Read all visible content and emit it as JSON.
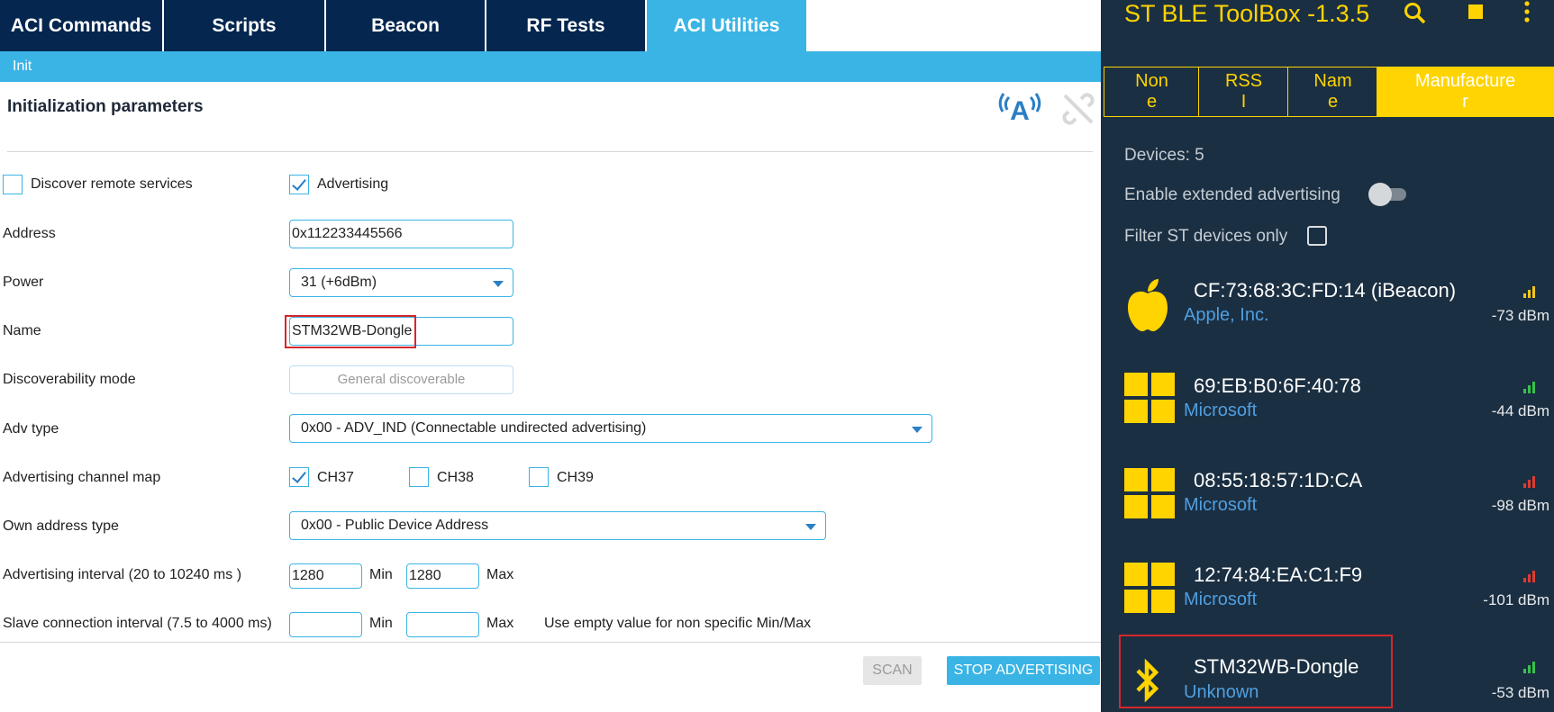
{
  "left": {
    "tabs": [
      "ACI Commands",
      "Scripts",
      "Beacon",
      "RF Tests",
      "ACI Utilities"
    ],
    "active_tab": "ACI Utilities",
    "subtab": "Init",
    "section_title": "Initialization parameters",
    "form": {
      "discover_remote_services": {
        "label": "Discover remote services",
        "checked": false
      },
      "advertising": {
        "label": "Advertising",
        "checked": true
      },
      "address": {
        "label": "Address",
        "value": "0x112233445566"
      },
      "power": {
        "label": "Power",
        "value": "31 (+6dBm)"
      },
      "name": {
        "label": "Name",
        "value": "STM32WB-Dongle"
      },
      "discoverability_mode": {
        "label": "Discoverability mode",
        "value": "General discoverable"
      },
      "adv_type": {
        "label": "Adv type",
        "value": "0x00 - ADV_IND (Connectable undirected advertising)"
      },
      "channel_map": {
        "label": "Advertising channel map",
        "channels": [
          {
            "label": "CH37",
            "checked": true
          },
          {
            "label": "CH38",
            "checked": false
          },
          {
            "label": "CH39",
            "checked": false
          }
        ]
      },
      "own_address_type": {
        "label": "Own address type",
        "value": "0x00 - Public Device Address"
      },
      "advertising_interval": {
        "label": "Advertising interval (20 to 10240 ms )",
        "min": "1280",
        "max": "1280",
        "min_label": "Min",
        "max_label": "Max"
      },
      "slave_connection_interval": {
        "label": "Slave connection interval (7.5 to 4000 ms)",
        "min": "",
        "max": "",
        "min_label": "Min",
        "max_label": "Max",
        "hint": "Use empty value for non specific Min/Max"
      }
    },
    "buttons": {
      "scan": "SCAN",
      "stop_advertising": "STOP ADVERTISING"
    },
    "colors": {
      "tab_bg": "#04264f",
      "accent": "#3ab4e5",
      "highlight": "#d6262b"
    }
  },
  "right": {
    "app_title": "ST BLE ToolBox -1.3.5",
    "sort_tabs": [
      "Non\ne",
      "RSS\nI",
      "Nam\ne",
      "Manufacture\nr"
    ],
    "active_sort_tab": "Manufacture\nr",
    "devices_count": "Devices: 5",
    "extended_adv_label": "Enable extended advertising",
    "filter_label": "Filter ST devices only",
    "devices": [
      {
        "address": "CF:73:68:3C:FD:14 (iBeacon)",
        "manufacturer": "Apple, Inc.",
        "rssi": "-73 dBm",
        "icon": "apple-icon",
        "signal_color": "#f5c518"
      },
      {
        "address": "69:EB:B0:6F:40:78",
        "manufacturer": "Microsoft",
        "rssi": "-44 dBm",
        "icon": "windows-icon",
        "signal_color": "#35c24a"
      },
      {
        "address": "08:55:18:57:1D:CA",
        "manufacturer": "Microsoft",
        "rssi": "-98 dBm",
        "icon": "windows-icon",
        "signal_color": "#e03a2f"
      },
      {
        "address": "12:74:84:EA:C1:F9",
        "manufacturer": "Microsoft",
        "rssi": "-101 dBm",
        "icon": "windows-icon",
        "signal_color": "#e03a2f"
      },
      {
        "address": "STM32WB-Dongle",
        "manufacturer": "Unknown",
        "rssi": "-53 dBm",
        "icon": "bluetooth-icon",
        "signal_color": "#35c24a"
      }
    ],
    "colors": {
      "bg": "#1b2f42",
      "accent": "#ffd400",
      "link": "#4f9fe0"
    }
  }
}
